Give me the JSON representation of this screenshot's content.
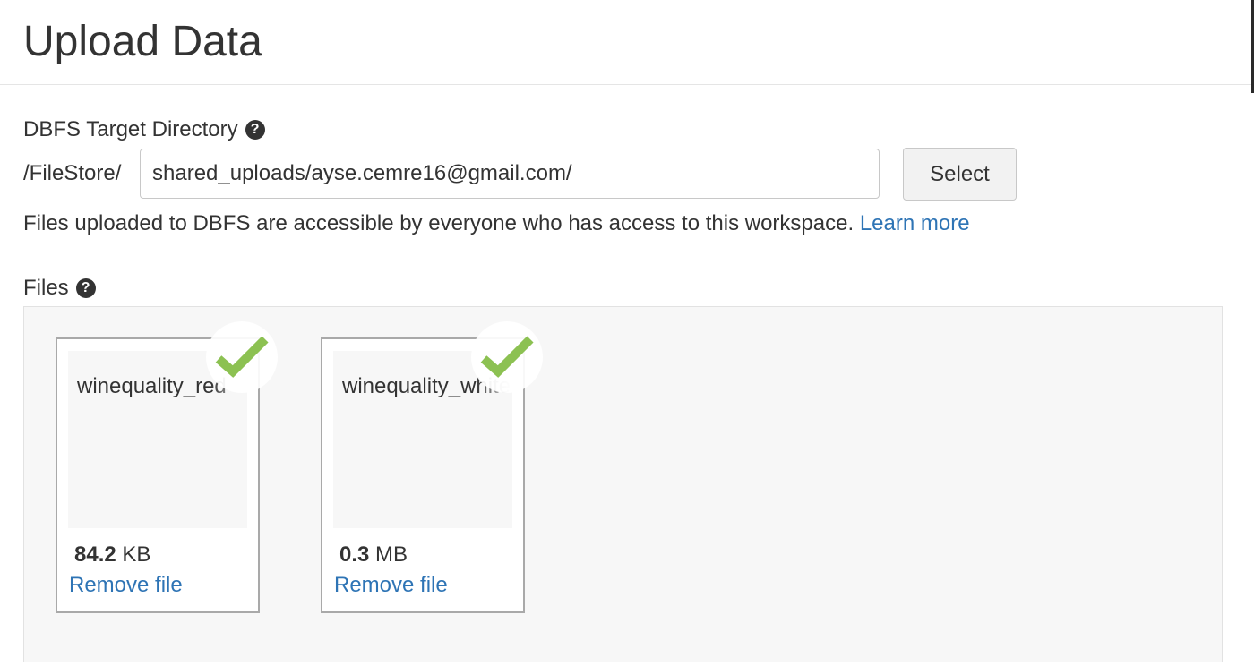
{
  "header": {
    "title": "Upload Data"
  },
  "target_directory": {
    "label": "DBFS Target Directory",
    "help_icon": "question-circle-icon",
    "prefix": "/FileStore/",
    "value": "shared_uploads/ayse.cemre16@gmail.com/",
    "select_label": "Select",
    "info_text": "Files uploaded to DBFS are accessible by everyone who has access to this workspace.",
    "learn_more": "Learn more"
  },
  "files": {
    "label": "Files",
    "help_icon": "question-circle-icon",
    "items": [
      {
        "name": "winequality_red",
        "size_value": "84.2",
        "size_unit": "KB",
        "remove_label": "Remove file",
        "status_icon": "checkmark-icon"
      },
      {
        "name": "winequality_white",
        "size_value": "0.3",
        "size_unit": "MB",
        "remove_label": "Remove file",
        "status_icon": "checkmark-icon"
      }
    ]
  },
  "colors": {
    "link": "#2e74b5",
    "success": "#8cc152",
    "dropzone_bg": "#f7f7f7",
    "text": "#333333"
  }
}
